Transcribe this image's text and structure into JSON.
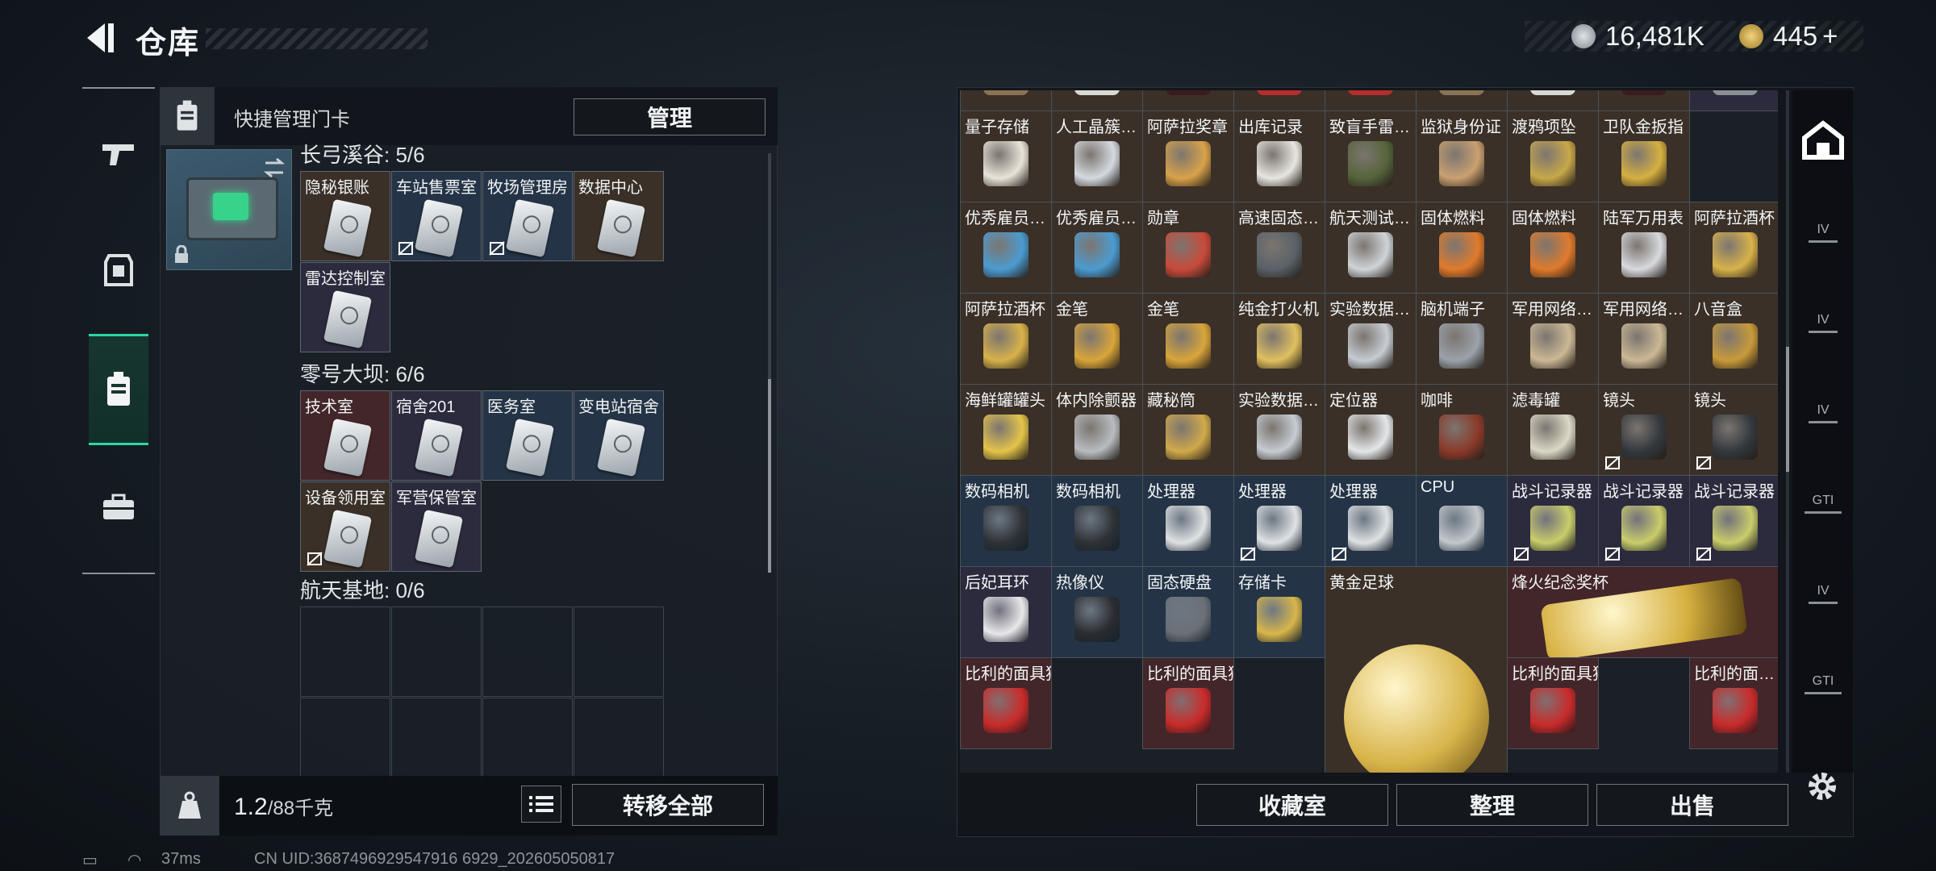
{
  "header": {
    "title": "仓库",
    "currency_1": "16,481K",
    "currency_2": "445",
    "plus": "+"
  },
  "left_tabs": [
    "weapon-tab",
    "armor-tab",
    "keycard-tab",
    "toolbox-tab"
  ],
  "quick_manage": {
    "label": "快捷管理门卡",
    "manage_button": "管理"
  },
  "sections": [
    {
      "header": "长弓溪谷: 5/6",
      "slots": [
        {
          "label": "隐秘银账",
          "no_drop": false,
          "bg": "#3a3028"
        },
        {
          "label": "车站售票室",
          "no_drop": true,
          "bg": "#243446"
        },
        {
          "label": "牧场管理房",
          "no_drop": true,
          "bg": "#243446"
        },
        {
          "label": "数据中心",
          "no_drop": false,
          "bg": "#3a3028"
        },
        {
          "label": "雷达控制室",
          "no_drop": false,
          "bg": "#2c2a3d"
        }
      ]
    },
    {
      "header": "零号大坝: 6/6",
      "slots": [
        {
          "label": "技术室",
          "no_drop": false,
          "bg": "#432629"
        },
        {
          "label": "宿舍201",
          "no_drop": false,
          "bg": "#2c2a3d"
        },
        {
          "label": "医务室",
          "no_drop": false,
          "bg": "#243446"
        },
        {
          "label": "变电站宿舍",
          "no_drop": false,
          "bg": "#243446"
        },
        {
          "label": "设备领用室",
          "no_drop": true,
          "bg": "#3a3028"
        },
        {
          "label": "军营保管室",
          "no_drop": false,
          "bg": "#2c2a3d"
        }
      ]
    },
    {
      "header": "航天基地: 0/6",
      "slots": []
    }
  ],
  "footer_left": {
    "weight": "1.2",
    "capacity": "/88千克",
    "transfer_all": "转移全部"
  },
  "items": [
    {
      "label": "量子存储",
      "c": 0,
      "r": 0,
      "bg": "bg-o",
      "color": "#e9e4da"
    },
    {
      "label": "人工晶簇…",
      "c": 1,
      "r": 0,
      "bg": "bg-o",
      "color": "#d5dae0"
    },
    {
      "label": "阿萨拉奖章",
      "c": 2,
      "r": 0,
      "bg": "bg-o",
      "color": "#d9a24a"
    },
    {
      "label": "出库记录",
      "c": 3,
      "r": 0,
      "bg": "bg-o",
      "color": "#e8e6e0"
    },
    {
      "label": "致盲手雷…",
      "c": 4,
      "r": 0,
      "bg": "bg-o",
      "color": "#56643b"
    },
    {
      "label": "监狱身份证",
      "c": 5,
      "r": 0,
      "bg": "bg-o",
      "color": "#c9a070"
    },
    {
      "label": "渡鸦项坠",
      "c": 6,
      "r": 0,
      "bg": "bg-o",
      "color": "#c8a84a"
    },
    {
      "label": "卫队金扳指",
      "c": 7,
      "r": 0,
      "bg": "bg-o",
      "color": "#d6b040"
    },
    {
      "label": "优秀雇员…",
      "c": 0,
      "r": 1,
      "bg": "bg-o",
      "color": "#4b9bd1"
    },
    {
      "label": "优秀雇员…",
      "c": 1,
      "r": 1,
      "bg": "bg-o",
      "color": "#4b9bd1"
    },
    {
      "label": "勋章",
      "c": 2,
      "r": 1,
      "bg": "bg-o",
      "color": "#c84a3a"
    },
    {
      "label": "高速固态…",
      "c": 3,
      "r": 1,
      "bg": "bg-o",
      "color": "#5a6168"
    },
    {
      "label": "航天测试…",
      "c": 4,
      "r": 1,
      "bg": "bg-o",
      "color": "#cfd4d8"
    },
    {
      "label": "固体燃料",
      "c": 5,
      "r": 1,
      "bg": "bg-o",
      "color": "#e07a2c"
    },
    {
      "label": "固体燃料",
      "c": 6,
      "r": 1,
      "bg": "bg-o",
      "color": "#e07a2c"
    },
    {
      "label": "陆军万用表",
      "c": 7,
      "r": 1,
      "bg": "bg-o",
      "color": "#d8dade"
    },
    {
      "label": "阿萨拉酒杯",
      "c": 8,
      "r": 1,
      "bg": "bg-o",
      "color": "#d8b24a"
    },
    {
      "label": "阿萨拉酒杯",
      "c": 0,
      "r": 2,
      "bg": "bg-o",
      "color": "#d8b24a"
    },
    {
      "label": "金笔",
      "c": 1,
      "r": 2,
      "bg": "bg-o",
      "color": "#d9a53a"
    },
    {
      "label": "金笔",
      "c": 2,
      "r": 2,
      "bg": "bg-o",
      "color": "#d9a53a"
    },
    {
      "label": "纯金打火机",
      "c": 3,
      "r": 2,
      "bg": "bg-o",
      "color": "#e0c060"
    },
    {
      "label": "实验数据…",
      "c": 4,
      "r": 2,
      "bg": "bg-o",
      "color": "#c6ccd2"
    },
    {
      "label": "脑机端子",
      "c": 5,
      "r": 2,
      "bg": "bg-o",
      "color": "#9aa2aa"
    },
    {
      "label": "军用网络…",
      "c": 6,
      "r": 2,
      "bg": "bg-o",
      "color": "#cbb895"
    },
    {
      "label": "军用网络…",
      "c": 7,
      "r": 2,
      "bg": "bg-o",
      "color": "#cbb895"
    },
    {
      "label": "八音盒",
      "c": 8,
      "r": 2,
      "bg": "bg-o",
      "color": "#c99a3a"
    },
    {
      "label": "海鲜罐罐头",
      "c": 0,
      "r": 3,
      "bg": "bg-o",
      "color": "#e4c44a"
    },
    {
      "label": "体内除颤器",
      "c": 1,
      "r": 3,
      "bg": "bg-o",
      "color": "#b8bcc0"
    },
    {
      "label": "藏秘筒",
      "c": 2,
      "r": 3,
      "bg": "bg-o",
      "color": "#d0a94a"
    },
    {
      "label": "实验数据…",
      "c": 3,
      "r": 3,
      "bg": "bg-o",
      "color": "#c6ccd2"
    },
    {
      "label": "定位器",
      "c": 4,
      "r": 3,
      "bg": "bg-o",
      "color": "#e4e7ea"
    },
    {
      "label": "咖啡",
      "c": 5,
      "r": 3,
      "bg": "bg-o",
      "color": "#8a3a2a"
    },
    {
      "label": "滤毒罐",
      "c": 6,
      "r": 3,
      "bg": "bg-o",
      "color": "#dcd8c6"
    },
    {
      "label": "镜头",
      "c": 7,
      "r": 3,
      "bg": "bg-o",
      "color": "#33383d",
      "no_drop": true
    },
    {
      "label": "镜头",
      "c": 8,
      "r": 3,
      "bg": "bg-o",
      "color": "#33383d",
      "no_drop": true
    },
    {
      "label": "数码相机",
      "c": 0,
      "r": 4,
      "bg": "bg-b",
      "color": "#2e3236"
    },
    {
      "label": "数码相机",
      "c": 1,
      "r": 4,
      "bg": "bg-b",
      "color": "#2e3236"
    },
    {
      "label": "处理器",
      "c": 2,
      "r": 4,
      "bg": "bg-b",
      "color": "#dfe2e4"
    },
    {
      "label": "处理器",
      "c": 3,
      "r": 4,
      "bg": "bg-b",
      "color": "#dfe2e4",
      "no_drop": true
    },
    {
      "label": "处理器",
      "c": 4,
      "r": 4,
      "bg": "bg-b",
      "color": "#dfe2e4",
      "no_drop": true
    },
    {
      "label": "CPU",
      "c": 5,
      "r": 4,
      "bg": "bg-b",
      "color": "#c2c8cc"
    },
    {
      "label": "战斗记录器",
      "c": 6,
      "r": 4,
      "bg": "bg-p",
      "color": "#c9cd6a",
      "no_drop": true
    },
    {
      "label": "战斗记录器",
      "c": 7,
      "r": 4,
      "bg": "bg-p",
      "color": "#c9cd6a",
      "no_drop": true
    },
    {
      "label": "战斗记录器",
      "c": 8,
      "r": 4,
      "bg": "bg-p",
      "color": "#c9cd6a",
      "no_drop": true
    },
    {
      "label": "后妃耳环",
      "c": 0,
      "r": 5,
      "bg": "bg-p",
      "color": "#e8e8ea"
    },
    {
      "label": "热像仪",
      "c": 1,
      "r": 5,
      "bg": "bg-b",
      "color": "#2a2d30"
    },
    {
      "label": "固态硬盘",
      "c": 2,
      "r": 5,
      "bg": "bg-b",
      "color": "#6a7076"
    },
    {
      "label": "存储卡",
      "c": 3,
      "r": 5,
      "bg": "bg-b",
      "color": "#d8b64a"
    },
    {
      "label": "比利的面具狼",
      "c": 0,
      "r": 6,
      "bg": "bg-r",
      "color": "#c92b2b"
    },
    {
      "label": "比利的面具狼",
      "c": 2,
      "r": 6,
      "bg": "bg-r",
      "color": "#c92b2b"
    },
    {
      "label": "比利的面具狼",
      "c": 6,
      "r": 6,
      "bg": "bg-r",
      "color": "#c92b2b"
    },
    {
      "label": "比利的面…",
      "c": 8,
      "r": 6,
      "bg": "bg-r",
      "color": "#c92b2b"
    }
  ],
  "big_items": [
    {
      "label": "黄金足球",
      "color": "#d8b44a",
      "bg": "bg-o"
    },
    {
      "label": "烽火纪念奖杯",
      "color": "#d6b040",
      "bg": "bg-r"
    }
  ],
  "right_sidebar": [
    "home-tab",
    "IV",
    "IV",
    "IV",
    "GTI",
    "IV",
    "GTI"
  ],
  "footer_right": {
    "collection": "收藏室",
    "sort": "整理",
    "sell": "出售"
  },
  "status_bar": {
    "ping": "37ms",
    "uid": "CN UID:3687496929547916 6929_202605050817"
  }
}
